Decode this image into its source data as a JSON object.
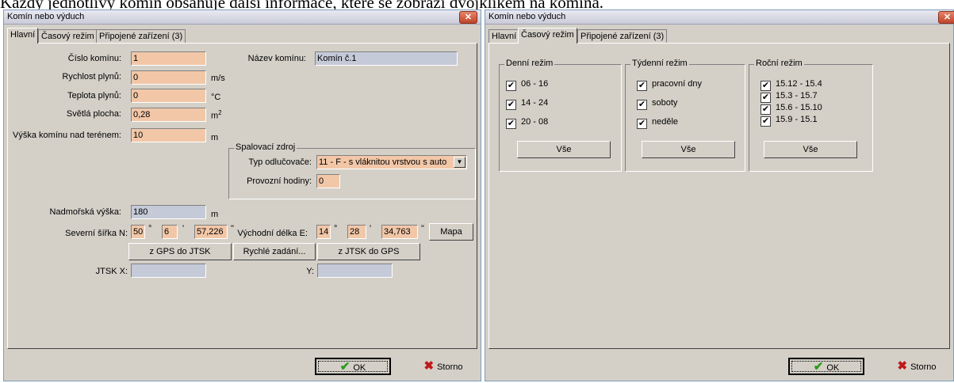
{
  "caption": "Každý jednotlivý komín obsahuje další informace, které se zobrazí dvojklikem na komína.",
  "left_window": {
    "title": "Komín nebo výduch",
    "tabs": [
      "Hlavní",
      "Časový režim",
      "Připojené zařízení (3)"
    ],
    "fields": {
      "cislo_kominu": {
        "label": "Číslo komínu:",
        "value": "1"
      },
      "nazev_kominu": {
        "label": "Název komínu:",
        "value": "Komín č.1"
      },
      "rychlost_plynu": {
        "label": "Rychlost plynů:",
        "value": "0",
        "unit": "m/s"
      },
      "teplota_plynu": {
        "label": "Teplota plynů:",
        "value": "0",
        "unit": "°C"
      },
      "svetla_plocha": {
        "label": "Světlá plocha:",
        "value": "0,28",
        "unit": "m",
        "unit_sup": "2"
      },
      "vyska_kominu": {
        "label": "Výška komínu nad terénem:",
        "value": "10",
        "unit": "m"
      },
      "nadmorska_vyska": {
        "label": "Nadmořská výška:",
        "value": "180",
        "unit": "m"
      }
    },
    "spalovaci_zdroj": {
      "legend": "Spalovací zdroj",
      "typ_label": "Typ odlučovače:",
      "typ_value": "11 - F - s vláknitou vrstvou s auto",
      "hodiny_label": "Provozní hodiny:",
      "hodiny_value": "0"
    },
    "coords": {
      "sever_label": "Severní šířka N:",
      "sever_deg": "50",
      "sever_min": "6",
      "sever_sec": "57,226",
      "vychod_label": "Východní délka E:",
      "vychod_deg": "14",
      "vychod_min": "28",
      "vychod_sec": "34,763",
      "deg_sym": "°",
      "min_sym": "'",
      "sec_sym": "\"",
      "mapa": "Mapa"
    },
    "buttons": {
      "gps_to_jtsk": "z GPS do JTSK",
      "rychle": "Rychlé zadání...",
      "jtsk_to_gps": "z JTSK do GPS"
    },
    "jtsk": {
      "x_label": "JTSK X:",
      "x_value": "",
      "y_label": "Y:",
      "y_value": ""
    },
    "ok": "OK",
    "storno": "Storno"
  },
  "right_window": {
    "title": "Komín nebo výduch",
    "tabs": [
      "Hlavní",
      "Časový režim",
      "Připojené zařízení (3)"
    ],
    "denni": {
      "legend": "Denní režim",
      "items": [
        "06 - 16",
        "14 - 24",
        "20 - 08"
      ],
      "button": "Vše"
    },
    "tydenni": {
      "legend": "Týdenní režim",
      "items": [
        "pracovní dny",
        "soboty",
        "neděle"
      ],
      "button": "Vše"
    },
    "rocni": {
      "legend": "Roční režim",
      "items": [
        "15.12 - 15.4",
        "15.3 - 15.7",
        "15.6 - 15.10",
        "15.9 - 15.1"
      ],
      "button": "Vše"
    },
    "checkmark": "✔",
    "ok": "OK",
    "storno": "Storno"
  },
  "colors": {
    "input_orange": "#f2c7a8",
    "input_gray": "#c5cad8",
    "ok_green": "#2e9a1f",
    "storno_red": "#c01818"
  }
}
